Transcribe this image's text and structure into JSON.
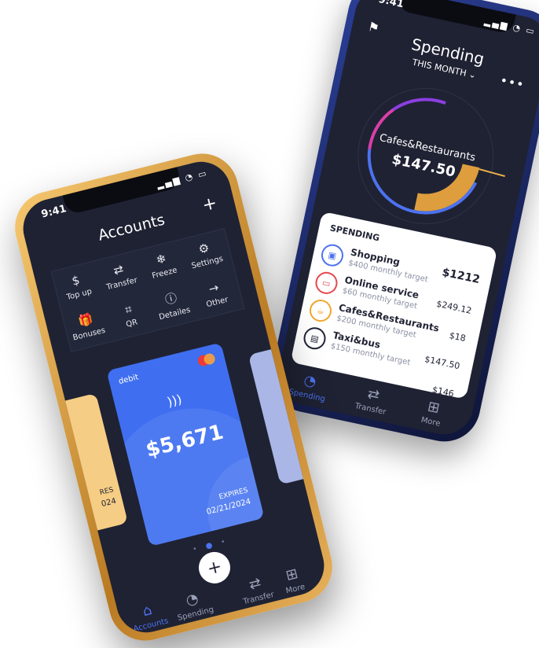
{
  "spending_phone": {
    "status_time": "9:41",
    "title": "Spending",
    "period": "THIS MONTH",
    "period_chevron": "chevron-down-icon",
    "donut_category": "Cafes&Restaurants",
    "donut_amount": "$147.50",
    "panel_title": "SPENDING",
    "panel_total": "$1212",
    "items": [
      {
        "name": "Shopping",
        "sub": "$400 monthly target",
        "amount": "",
        "icon": "bag-icon",
        "color": "#4c72f0"
      },
      {
        "name": "Online service",
        "sub": "$60 monthly target",
        "amount": "$249.12",
        "icon": "cart-icon",
        "color": "#e5484d"
      },
      {
        "name": "Cafes&Restaurants",
        "sub": "$200 monthly target",
        "amount": "$18",
        "icon": "cup-icon",
        "color": "#f0a72e"
      },
      {
        "name": "Taxi&bus",
        "sub": "$150 monthly target",
        "amount": "$147.50",
        "icon": "bus-icon",
        "color": "#1f2233"
      },
      {
        "name": "",
        "sub": "",
        "amount": "$146",
        "icon": "",
        "color": "#1f2233"
      }
    ],
    "tabs": [
      {
        "label": "Spending",
        "icon": "pie-icon",
        "active": true
      },
      {
        "label": "Transfer",
        "icon": "transfer-icon",
        "active": false
      },
      {
        "label": "More",
        "icon": "grid-icon",
        "active": false
      }
    ]
  },
  "accounts_phone": {
    "status_time": "9:41",
    "title": "Accounts",
    "add_label": "+",
    "actions": [
      {
        "label": "Top up",
        "glyph": "$"
      },
      {
        "label": "Transfer",
        "glyph": "⇄"
      },
      {
        "label": "Freeze",
        "glyph": "❄"
      },
      {
        "label": "Settings",
        "glyph": "⚙"
      },
      {
        "label": "Bonuses",
        "glyph": "🎁"
      },
      {
        "label": "QR",
        "glyph": "⌗"
      },
      {
        "label": "Detailes",
        "glyph": "ⓘ"
      },
      {
        "label": "Other",
        "glyph": "→"
      }
    ],
    "card": {
      "type": "debit",
      "balance": "$5,671",
      "expires_label": "EXPIRES",
      "expires_date": "02/21/2024"
    },
    "side_card": {
      "expires_label": "RES",
      "expires_date": "024"
    },
    "fab_label": "+",
    "tabs": [
      {
        "label": "Accounts",
        "icon": "home-icon",
        "active": true
      },
      {
        "label": "Spending",
        "icon": "pie-icon",
        "active": false
      },
      {
        "label": "Transfer",
        "icon": "transfer-icon",
        "active": false
      },
      {
        "label": "More",
        "icon": "grid-icon",
        "active": false
      }
    ]
  },
  "colors": {
    "screen_bg": "#1f2233",
    "accent_blue": "#4c72f0",
    "gold_frame": "#e9b25a",
    "navy_frame": "#243a8a",
    "donut_orange": "#f0b24a"
  }
}
